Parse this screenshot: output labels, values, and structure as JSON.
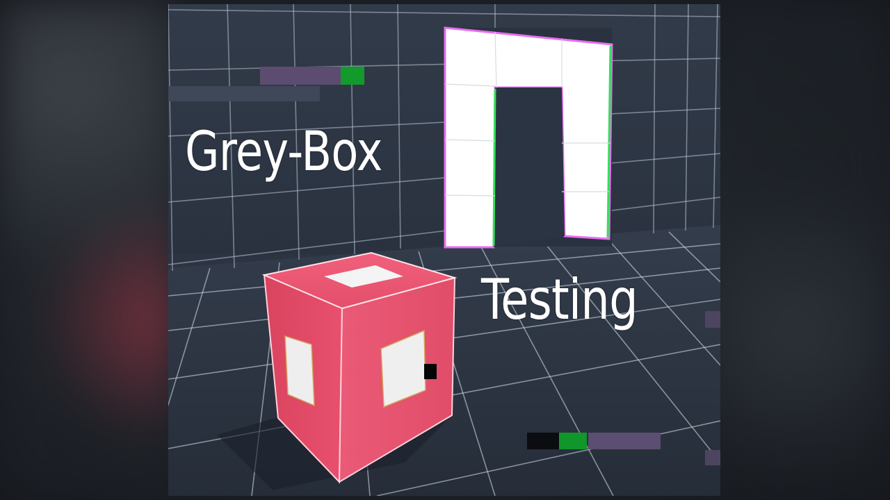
{
  "captions": {
    "line1": "Grey-Box",
    "line2": "Testing"
  },
  "colors": {
    "background": "#1d2128",
    "scene_floor": "#2c3442",
    "grid_line": "#b9c7d6",
    "doorway": "#ffffff",
    "cube": "#e8506d",
    "cube_window": "#f2f2f2",
    "glitch_green": "#119a2a",
    "glitch_purple": "#5a4a6e",
    "text": "#ffffff"
  }
}
